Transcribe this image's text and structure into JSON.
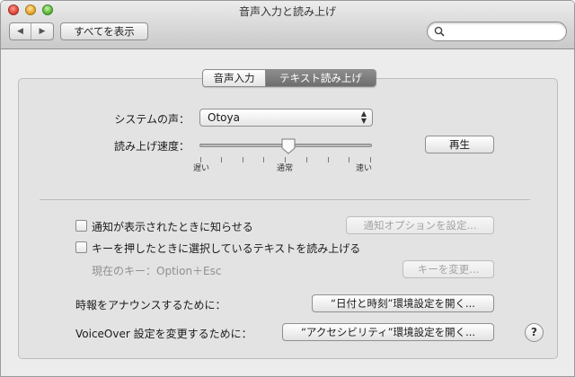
{
  "window": {
    "title": "音声入力と読み上げ"
  },
  "toolbar": {
    "back_icon": "◀",
    "forward_icon": "▶",
    "show_all_label": "すべてを表示",
    "search_value": "",
    "search_placeholder": ""
  },
  "tabs": [
    {
      "label": "音声入力",
      "selected": false
    },
    {
      "label": "テキスト読み上げ",
      "selected": true
    }
  ],
  "tts": {
    "system_voice_label": "システムの声：",
    "system_voice_value": "Otoya",
    "rate_label": "読み上げ速度：",
    "rate_level": 0.5,
    "rate_ticks": [
      "遅い",
      "通常",
      "速い"
    ],
    "play_label": "再生"
  },
  "notifications": {
    "announce_label": "通知が表示されたときに知らせる",
    "announce_checked": false,
    "options_button": "通知オプションを設定..."
  },
  "speak_selection": {
    "label": "キーを押したときに選択しているテキストを読み上げる",
    "checked": false,
    "current_key": "現在のキー：Option＋Esc",
    "change_key_button": "キーを変更..."
  },
  "time": {
    "label": "時報をアナウンスするために：",
    "button": "“日付と時刻”環境設定を開く..."
  },
  "voiceover": {
    "label": "VoiceOver 設定を変更するために：",
    "button": "“アクセシビリティ”環境設定を開く..."
  },
  "help_label": "?"
}
